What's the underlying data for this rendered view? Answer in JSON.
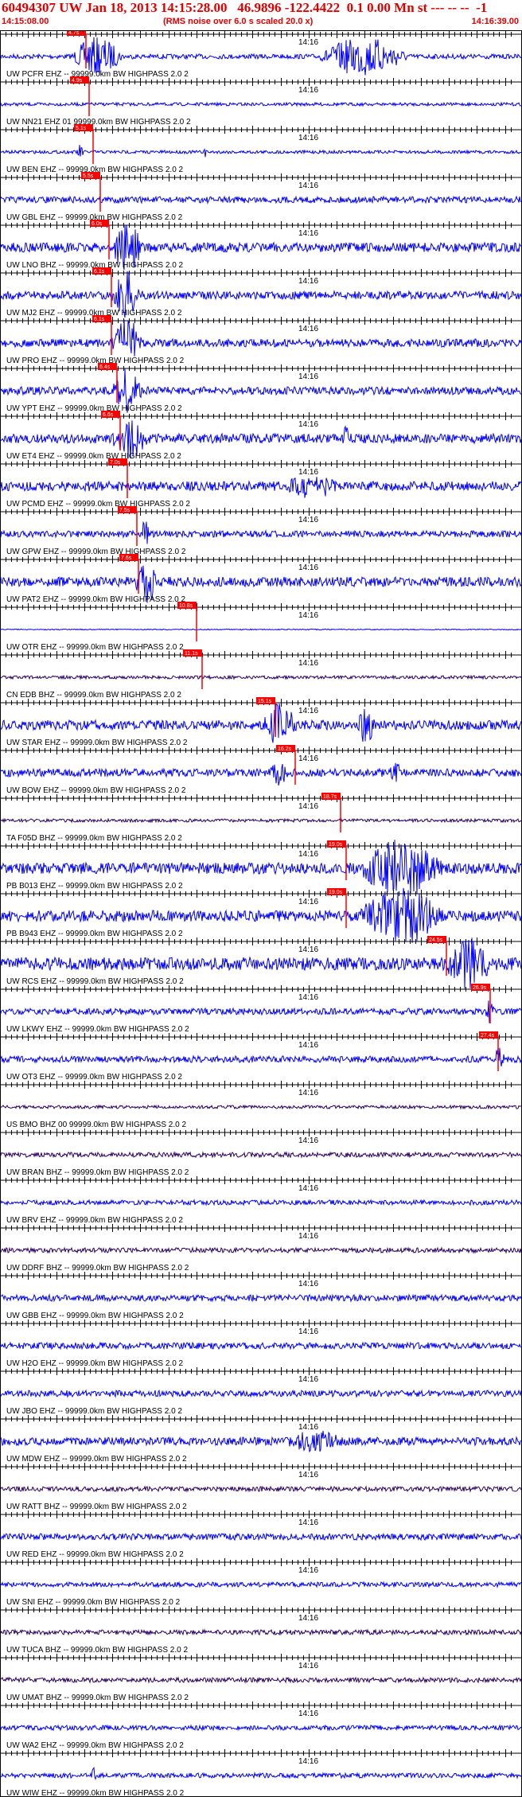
{
  "header": {
    "title": "60494307 UW Jan 18, 2013 14:15:28.00   46.9896 -122.4422  0.1 0.00 Mn st --- -- --  -1",
    "start_time": "14:15:08.00",
    "note": "(RMS noise over 6.0 s scaled 20.0 x)",
    "end_time": "14:16:39.00"
  },
  "minute_label": "14:16",
  "colors": {
    "trace_blue": "#0000ff",
    "trace_dark": "#2a0060",
    "pick_red": "#ff0000",
    "header_red": "#e00000"
  },
  "traces": [
    {
      "label": "UW PCFR EHZ -- 99999.0km BW  HIGHPASS  2.0  2",
      "pick": "4.7s",
      "color": "#0000ff"
    },
    {
      "label": "UW NN21 EHZ 01 99999.0km BW  HIGHPASS  2.0  2",
      "pick": "4.9s",
      "color": "#0000ff"
    },
    {
      "label": "UW BEN EHZ -- 99999.0km BW  HIGHPASS  2.0  2",
      "pick": "5.1s",
      "color": "#0000ff"
    },
    {
      "label": "UW GBL EHZ -- 99999.0km BW  HIGHPASS  2.0  2",
      "pick": "5.5s",
      "color": "#0000ff"
    },
    {
      "label": "UW LNO BHZ -- 99999.0km BW  HIGHPASS  2.0  2",
      "pick": "6.0s",
      "color": "#0000ff"
    },
    {
      "label": "UW MJ2 EHZ -- 99999.0km BW  HIGHPASS  2.0  2",
      "pick": "6.1s",
      "color": "#0000ff"
    },
    {
      "label": "UW PRO EHZ -- 99999.0km BW  HIGHPASS  2.0  2",
      "pick": "6.1s",
      "color": "#0000ff"
    },
    {
      "label": "UW YPT EHZ -- 99999.0km BW  HIGHPASS  2.0  2",
      "pick": "6.4s",
      "color": "#0000ff"
    },
    {
      "label": "UW ET4 EHZ -- 99999.0km BW  HIGHPASS  2.0  2",
      "pick": "6.6s",
      "color": "#0000ff"
    },
    {
      "label": "UW PCMD EHZ -- 99999.0km BW  HIGHPASS  2.0  2",
      "pick": "7.0s",
      "color": "#0000ff"
    },
    {
      "label": "UW GPW EHZ -- 99999.0km BW  HIGHPASS  2.0  2",
      "pick": "7.5s",
      "color": "#0000ff"
    },
    {
      "label": "UW PAT2 EHZ -- 99999.0km BW  HIGHPASS  2.0  2",
      "pick": "7.6s",
      "color": "#0000ff"
    },
    {
      "label": "UW OTR EHZ -- 99999.0km BW  HIGHPASS  2.0  2",
      "pick": "10.8s",
      "color": "#0000ff"
    },
    {
      "label": "CN EDB BHZ -- 99999.0km BW  HIGHPASS  2.0  2",
      "pick": "11.1s",
      "color": "#2a0060"
    },
    {
      "label": "UW STAR EHZ -- 99999.0km BW  HIGHPASS  2.0  2",
      "pick": "15.1s",
      "color": "#0000ff"
    },
    {
      "label": "UW BOW EHZ -- 99999.0km BW  HIGHPASS  2.0  2",
      "pick": "16.2s",
      "color": "#0000ff"
    },
    {
      "label": "TA F05D BHZ -- 99999.0km BW  HIGHPASS  2.0  2",
      "pick": "18.7s",
      "color": "#2a0060"
    },
    {
      "label": "PB B013 EHZ -- 99999.0km BW  HIGHPASS  2.0  2",
      "pick": "19.0s",
      "color": "#0000ff"
    },
    {
      "label": "PB B943 EHZ -- 99999.0km BW  HIGHPASS  2.0  2",
      "pick": "19.0s",
      "color": "#0000ff"
    },
    {
      "label": "UW RCS EHZ -- 99999.0km BW  HIGHPASS  2.0  2",
      "pick": "24.5s",
      "color": "#0000ff"
    },
    {
      "label": "UW LKWY EHZ -- 99999.0km BW  HIGHPASS  2.0  2",
      "pick": "26.9s",
      "color": "#0000ff"
    },
    {
      "label": "UW OT3 EHZ -- 99999.0km BW  HIGHPASS  2.0  2",
      "pick": "27.4s",
      "color": "#0000ff"
    },
    {
      "label": "US BMO BHZ 00 99999.0km BW  HIGHPASS  2.0  2",
      "pick": "",
      "color": "#2a0060"
    },
    {
      "label": "UW BRAN BHZ -- 99999.0km BW  HIGHPASS  2.0  2",
      "pick": "",
      "color": "#2a0060"
    },
    {
      "label": "UW BRV EHZ -- 99999.0km BW  HIGHPASS  2.0  2",
      "pick": "",
      "color": "#0000ff"
    },
    {
      "label": "UW DDRF BHZ -- 99999.0km BW  HIGHPASS  2.0  2",
      "pick": "",
      "color": "#2a0060"
    },
    {
      "label": "UW GBB EHZ -- 99999.0km BW  HIGHPASS  2.0  2",
      "pick": "",
      "color": "#0000ff"
    },
    {
      "label": "UW H2O EHZ -- 99999.0km BW  HIGHPASS  2.0  2",
      "pick": "",
      "color": "#0000ff"
    },
    {
      "label": "UW JBO EHZ -- 99999.0km BW  HIGHPASS  2.0  2",
      "pick": "",
      "color": "#0000ff"
    },
    {
      "label": "UW MDW EHZ -- 99999.0km BW  HIGHPASS  2.0  2",
      "pick": "",
      "color": "#0000ff"
    },
    {
      "label": "UW RATT BHZ -- 99999.0km BW  HIGHPASS  2.0  2",
      "pick": "",
      "color": "#2a0060"
    },
    {
      "label": "UW RED EHZ -- 99999.0km BW  HIGHPASS  2.0  2",
      "pick": "",
      "color": "#0000ff"
    },
    {
      "label": "UW SNI EHZ -- 99999.0km BW  HIGHPASS  2.0  2",
      "pick": "",
      "color": "#0000ff"
    },
    {
      "label": "UW TUCA BHZ -- 99999.0km BW  HIGHPASS  2.0  2",
      "pick": "",
      "color": "#2a0060"
    },
    {
      "label": "UW UMAT BHZ -- 99999.0km BW  HIGHPASS  2.0  2",
      "pick": "",
      "color": "#2a0060"
    },
    {
      "label": "UW WA2 EHZ -- 99999.0km BW  HIGHPASS  2.0  2",
      "pick": "",
      "color": "#0000ff"
    },
    {
      "label": "UW WIW EHZ -- 99999.0km BW  HIGHPASS  2.0  2",
      "pick": "",
      "color": "#0000ff"
    }
  ]
}
